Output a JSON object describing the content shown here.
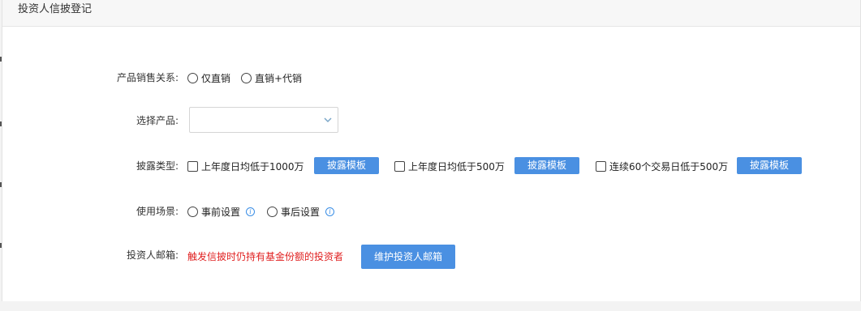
{
  "header": {
    "title": "投资人信披登记"
  },
  "sales_relation": {
    "label": "产品销售关系:",
    "options": [
      "仅直销",
      "直销+代销"
    ]
  },
  "product_select": {
    "label": "选择产品:",
    "value": ""
  },
  "disclosure_type": {
    "label": "披露类型:",
    "options": [
      {
        "text": "上年度日均低于1000万",
        "button": "披露模板"
      },
      {
        "text": "上年度日均低于500万",
        "button": "披露模板"
      },
      {
        "text": "连续60个交易日低于500万",
        "button": "披露模板"
      }
    ]
  },
  "usage_scene": {
    "label": "使用场景:",
    "options": [
      "事前设置",
      "事后设置"
    ],
    "info_icon": "info-circle-icon"
  },
  "investor_email": {
    "label": "投资人邮箱:",
    "warning": "触发信披时仍持有基金份额的投资者",
    "button": "维护投资人邮箱"
  },
  "colors": {
    "accent": "#4a90e2",
    "warning": "#e02020",
    "info": "#3a8ee6"
  }
}
